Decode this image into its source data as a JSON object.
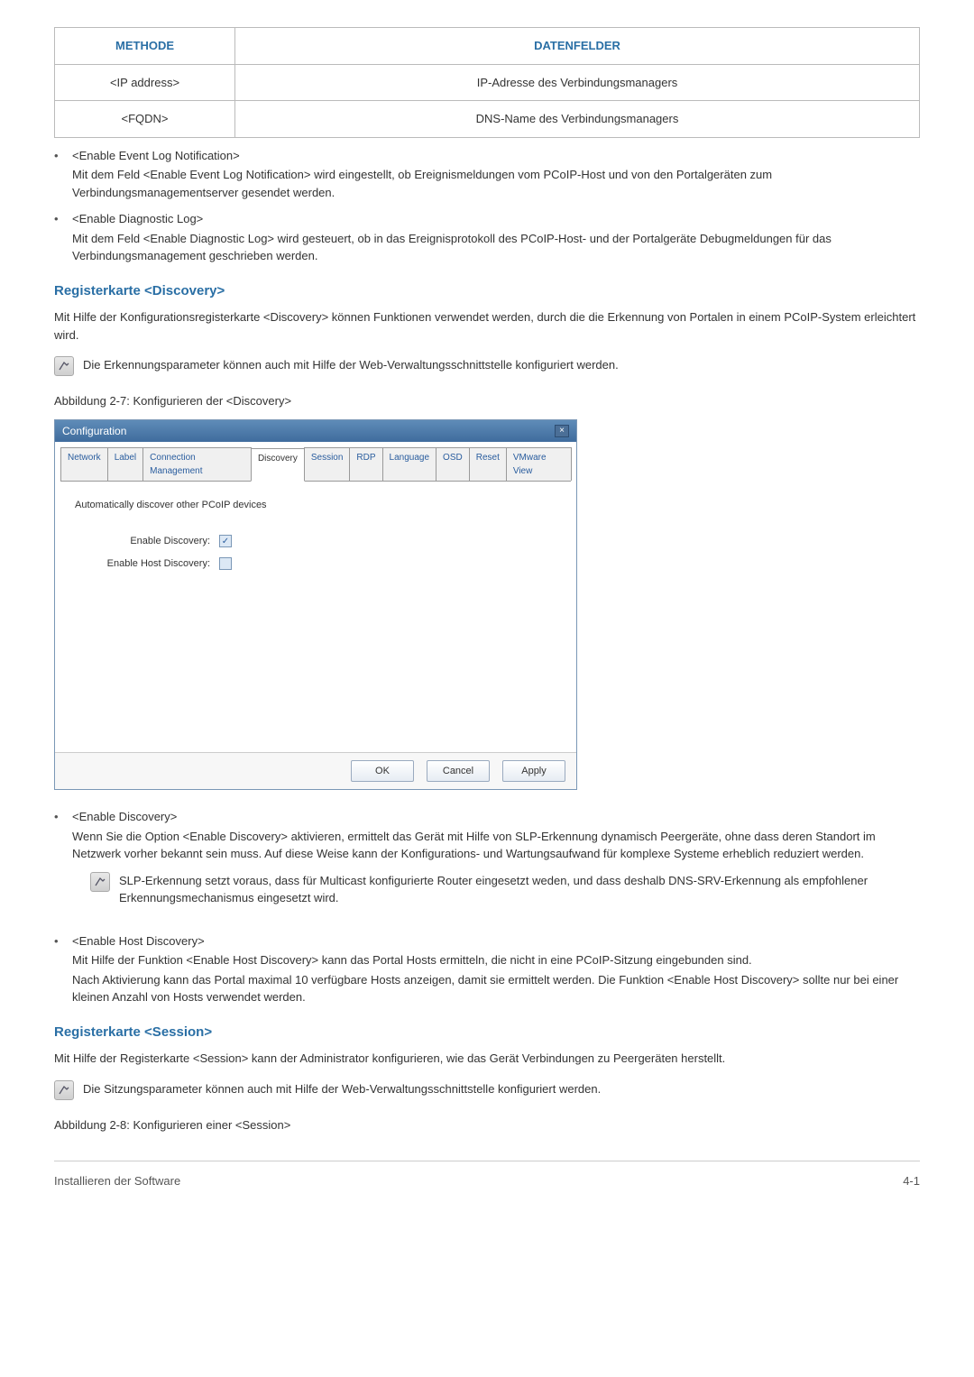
{
  "table": {
    "headers": [
      "METHODE",
      "DATENFELDER"
    ],
    "rows": [
      {
        "method": "<IP address>",
        "field": "IP-Adresse des Verbindungsmanagers"
      },
      {
        "method": "<FQDN>",
        "field": "DNS-Name des Verbindungsmanagers"
      }
    ]
  },
  "cm_bullets": [
    {
      "title": "<Enable Event Log Notification>",
      "desc": "Mit dem Feld <Enable Event Log Notification> wird eingestellt, ob Ereignismeldungen vom PCoIP-Host und von den Portalgeräten zum Verbindungsmanagementserver gesendet werden."
    },
    {
      "title": "<Enable Diagnostic Log>",
      "desc": "Mit dem Feld <Enable Diagnostic Log> wird gesteuert, ob in das Ereignisprotokoll des PCoIP-Host- und der Portalgeräte Debugmeldungen für das Verbindungsmanagement geschrieben werden."
    }
  ],
  "discovery": {
    "heading": "Registerkarte <Discovery>",
    "intro": "Mit Hilfe der Konfigurationsregisterkarte <Discovery> können Funktionen verwendet werden, durch die die Erkennung von Portalen in einem PCoIP-System erleichtert wird.",
    "note": "Die Erkennungsparameter können auch mit Hilfe der Web-Verwaltungsschnittstelle konfiguriert werden.",
    "caption": "Abbildung 2-7: Konfigurieren der <Discovery>"
  },
  "dialog": {
    "title": "Configuration",
    "tabs": [
      "Network",
      "Label",
      "Connection Management",
      "Discovery",
      "Session",
      "RDP",
      "Language",
      "OSD",
      "Reset",
      "VMware View"
    ],
    "active_tab_index": 3,
    "subhead": "Automatically discover other PCoIP devices",
    "fields": [
      {
        "label": "Enable Discovery:",
        "checked": true
      },
      {
        "label": "Enable Host Discovery:",
        "checked": false
      }
    ],
    "buttons": {
      "ok": "OK",
      "cancel": "Cancel",
      "apply": "Apply"
    }
  },
  "discovery_bullets": [
    {
      "title": "<Enable Discovery>",
      "desc": "Wenn Sie die Option <Enable Discovery> aktivieren, ermittelt das Gerät mit Hilfe von SLP-Erkennung dynamisch Peergeräte, ohne dass deren Standort im Netzwerk vorher bekannt sein muss. Auf diese Weise kann der Konfigurations- und Wartungsaufwand für komplexe Systeme erheblich reduziert werden.",
      "note": "SLP-Erkennung setzt voraus, dass für Multicast konfigurierte Router eingesetzt weden, und dass deshalb DNS-SRV-Erkennung als empfohlener Erkennungsmechanismus eingesetzt wird."
    },
    {
      "title": "<Enable Host Discovery>",
      "desc": "Mit Hilfe der Funktion <Enable Host Discovery> kann das Portal Hosts ermitteln, die nicht in eine PCoIP-Sitzung eingebunden sind.",
      "desc2": "Nach Aktivierung kann das Portal maximal 10 verfügbare Hosts anzeigen, damit sie ermittelt werden. Die Funktion <Enable Host Discovery> sollte nur bei einer kleinen Anzahl von Hosts verwendet werden."
    }
  ],
  "session": {
    "heading": "Registerkarte <Session>",
    "intro": "Mit Hilfe der Registerkarte <Session> kann der Administrator konfigurieren, wie das Gerät Verbindungen zu Peergeräten herstellt.",
    "note": "Die Sitzungsparameter können auch mit Hilfe der Web-Verwaltungsschnittstelle konfiguriert werden.",
    "caption": "Abbildung 2-8: Konfigurieren einer <Session>"
  },
  "footer": {
    "left": "Installieren der Software",
    "right": "4-1"
  }
}
